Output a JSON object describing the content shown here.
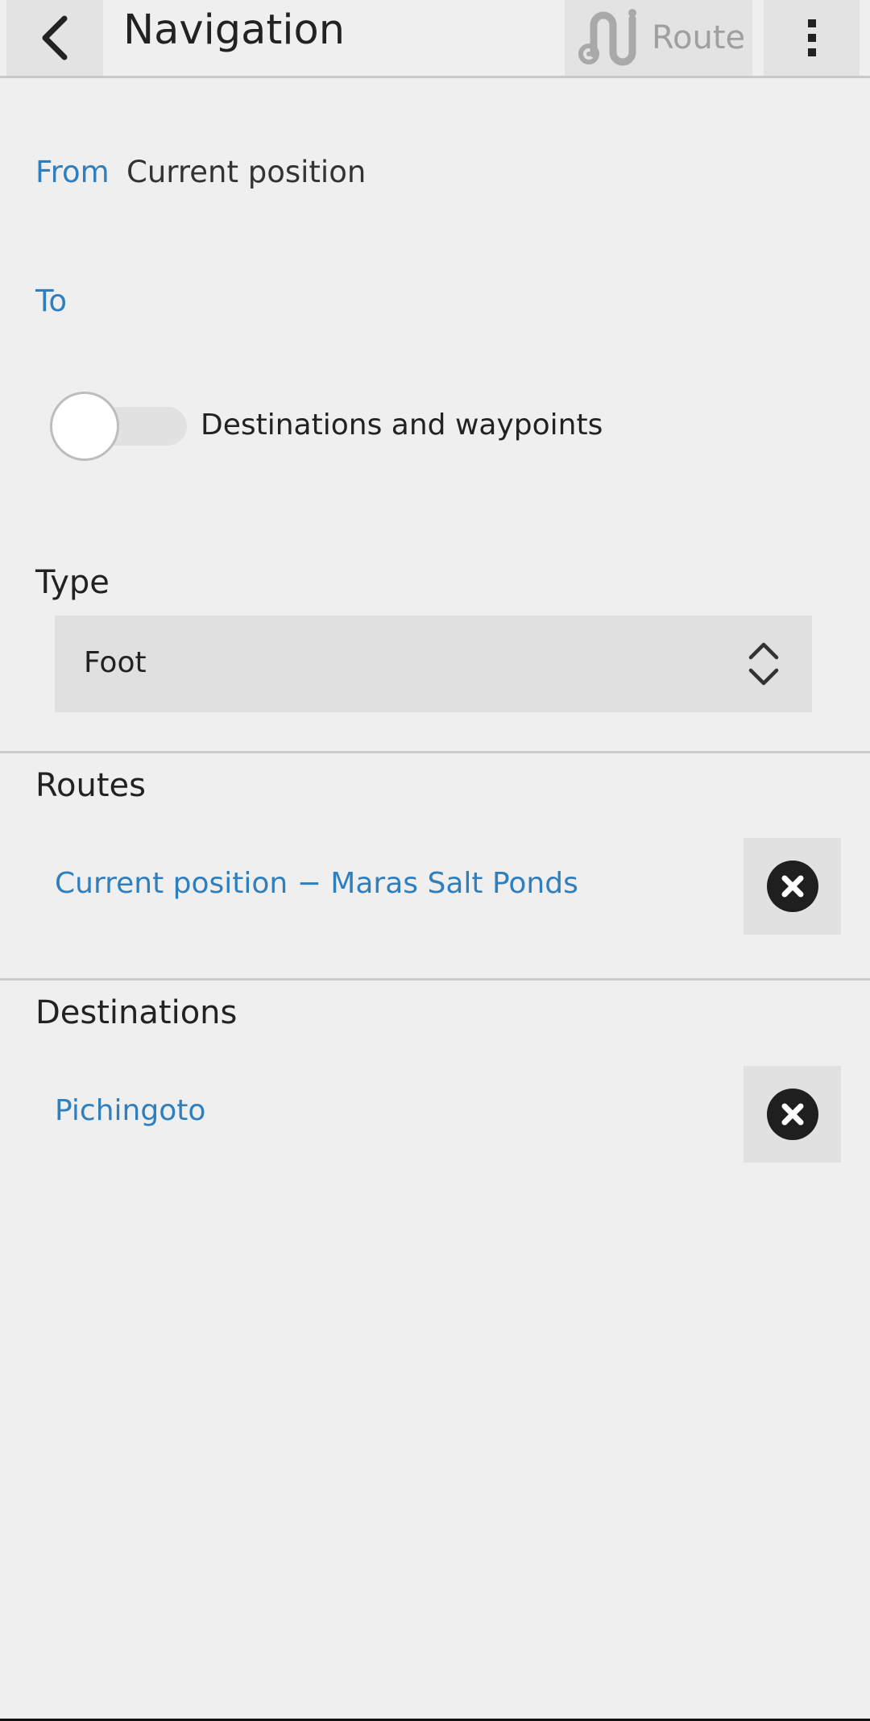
{
  "header": {
    "title": "Navigation",
    "route_label": "Route",
    "back_icon": "chevron-left-icon",
    "route_icon": "route-icon",
    "more_icon": "more-vert-icon"
  },
  "form": {
    "from_label": "From",
    "from_value": "Current position",
    "to_label": "To",
    "to_value": "",
    "waypoints_toggle": {
      "label": "Destinations and waypoints",
      "on": false
    }
  },
  "type": {
    "heading": "Type",
    "selected": "Foot",
    "icon": "select-arrows-icon"
  },
  "routes": {
    "heading": "Routes",
    "items": [
      {
        "label": "Current position − Maras Salt Ponds",
        "remove_icon": "close-circle-icon"
      }
    ]
  },
  "destinations": {
    "heading": "Destinations",
    "items": [
      {
        "label": "Pichingoto",
        "remove_icon": "close-circle-icon"
      }
    ]
  },
  "colors": {
    "accent": "#2f7fbf",
    "background": "#efefef",
    "button_bg": "#e3e3e3",
    "disabled_text": "#9f9f9f"
  }
}
